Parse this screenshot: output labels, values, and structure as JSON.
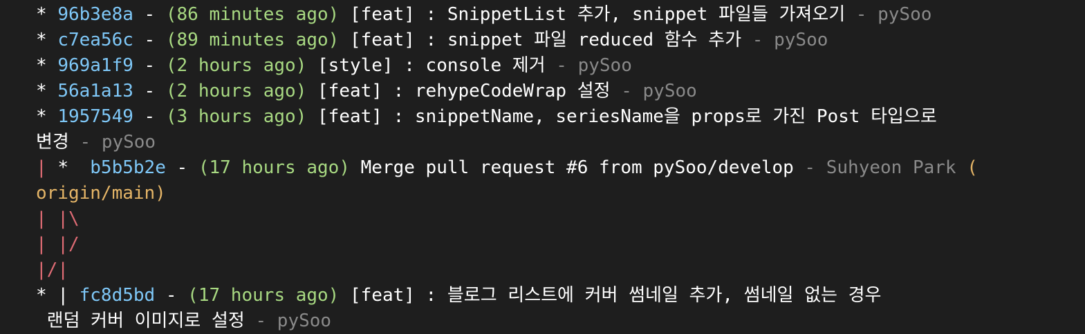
{
  "commits": [
    {
      "graph": "* ",
      "hash": "96b3e8a",
      "time": "(86 minutes ago)",
      "message": "[feat] : SnippetList 추가, snippet 파일들 가져오기",
      "author": "pySoo"
    },
    {
      "graph": "* ",
      "hash": "c7ea56c",
      "time": "(89 minutes ago)",
      "message": "[feat] : snippet 파일 reduced 함수 추가",
      "author": "pySoo"
    },
    {
      "graph": "* ",
      "hash": "969a1f9",
      "time": "(2 hours ago)",
      "message": "[style] : console 제거",
      "author": "pySoo"
    },
    {
      "graph": "* ",
      "hash": "56a1a13",
      "time": "(2 hours ago)",
      "message": "[feat] : rehypeCodeWrap 설정",
      "author": "pySoo"
    },
    {
      "graph": "* ",
      "hash": "1957549",
      "time": "(3 hours ago)",
      "message": "[feat] : snippetName, seriesName을 props로 가진 Post 타입으로",
      "message_cont": "변경",
      "author": "pySoo"
    }
  ],
  "merge": {
    "graph_bar": "| ",
    "graph_star": "*  ",
    "hash": "b5b5b2e",
    "time": "(17 hours ago)",
    "message": "Merge pull request #6 from pySoo/develop",
    "author": "Suhyeon Park",
    "ref_open": "(",
    "ref": "origin/main)"
  },
  "graph_lines": [
    "| |\\",
    "| |/",
    "|/|"
  ],
  "last_commit": {
    "graph_star": "* ",
    "graph_bar": "| ",
    "hash": "fc8d5bd",
    "time": "(17 hours ago)",
    "message": "[feat] : 블로그 리스트에 커버 썸네일 추가, 썸네일 없는 경우",
    "message_cont": " 랜덤 커버 이미지로 설정",
    "author": "pySoo"
  },
  "separator": " - "
}
